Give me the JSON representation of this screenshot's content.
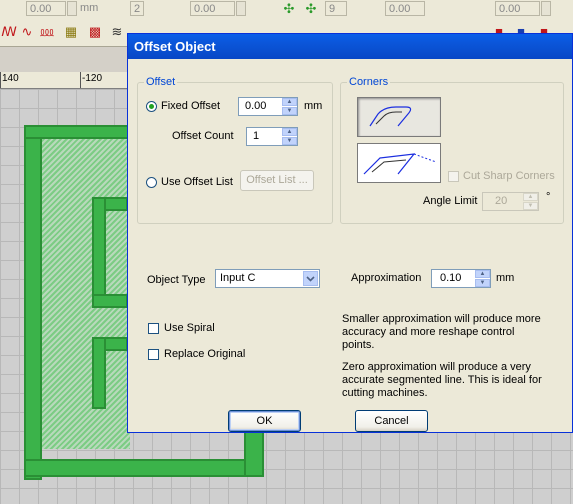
{
  "toolbar": {
    "field1_value": "0.00",
    "field2_value": "2",
    "field3_value": "0.00",
    "field4_value": "9",
    "field5_value": "0.00",
    "field6_value": "0.00",
    "unit": "mm"
  },
  "ruler": {
    "labels": [
      "140",
      "-120"
    ]
  },
  "dialog": {
    "title": "Offset Object",
    "offset_group": {
      "label": "Offset",
      "fixed_offset_label": "Fixed Offset",
      "fixed_offset_value": "0.00",
      "fixed_offset_unit": "mm",
      "offset_count_label": "Offset Count",
      "offset_count_value": "1",
      "use_offset_list_label": "Use Offset List",
      "offset_list_button": "Offset List ..."
    },
    "corners_group": {
      "label": "Corners",
      "cut_sharp_corners_label": "Cut Sharp Corners",
      "angle_limit_label": "Angle Limit",
      "angle_limit_value": "20",
      "angle_unit": "°"
    },
    "object_type_label": "Object Type",
    "object_type_value": "Input C",
    "approximation_label": "Approximation",
    "approximation_value": "0.10",
    "approximation_unit": "mm",
    "use_spiral_label": "Use Spiral",
    "replace_original_label": "Replace Original",
    "info_text_1": "Smaller approximation will produce more accuracy and more reshape control points.",
    "info_text_2": "Zero approximation will produce a very accurate segmented line. This is ideal for cutting machines.",
    "ok_label": "OK",
    "cancel_label": "Cancel"
  },
  "colors": {
    "titlebar": "#0a5fe8",
    "dialog_bg": "#ece9d8",
    "group_label": "#0046d5",
    "stitch_green": "#3bb34a"
  }
}
